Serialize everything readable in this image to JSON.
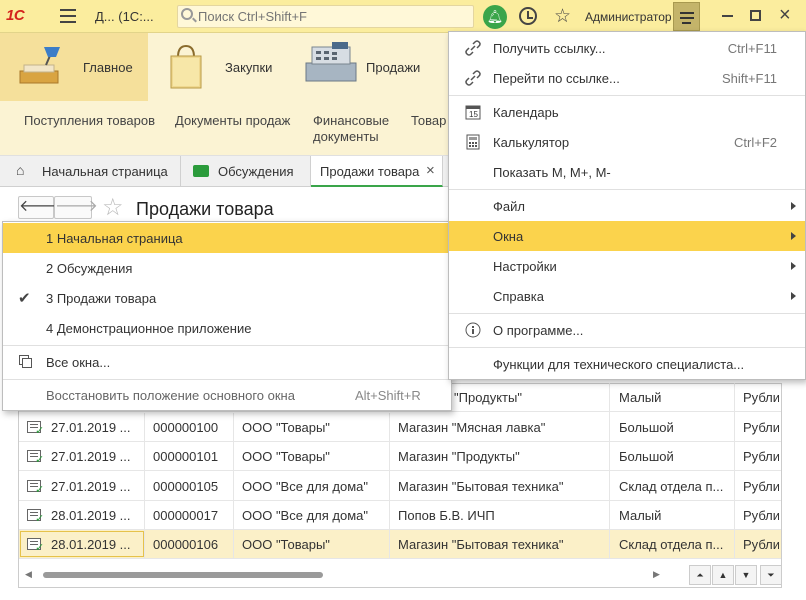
{
  "titlebar": {
    "logo": "1С",
    "title": "Д... (1С:...",
    "search_placeholder": "Поиск Ctrl+Shift+F",
    "user": "Администратор"
  },
  "sections": [
    {
      "label": "Главное"
    },
    {
      "label": "Закупки"
    },
    {
      "label": "Продажи"
    }
  ],
  "subsections": [
    {
      "label": "Поступления товаров"
    },
    {
      "label": "Документы продаж"
    },
    {
      "label": "Финансовые документы"
    },
    {
      "label": "Товар"
    }
  ],
  "tabs": [
    {
      "label": "Начальная страница"
    },
    {
      "label": "Обсуждения"
    },
    {
      "label": "Продажи товара"
    }
  ],
  "page": {
    "title": "Продажи товара"
  },
  "main_menu": {
    "items": [
      {
        "label": "Получить ссылку...",
        "shortcut": "Ctrl+F11",
        "icon": "link-icon"
      },
      {
        "label": "Перейти по ссылке...",
        "shortcut": "Shift+F11",
        "icon": "goto-link-icon"
      },
      {
        "label": "Календарь",
        "shortcut": "",
        "icon": "calendar-icon"
      },
      {
        "label": "Калькулятор",
        "shortcut": "Ctrl+F2",
        "icon": "calculator-icon"
      },
      {
        "label": "Показать M, M+, M-",
        "shortcut": ""
      },
      {
        "label": "Файл",
        "submenu": true
      },
      {
        "label": "Окна",
        "submenu": true,
        "highlighted": true
      },
      {
        "label": "Настройки",
        "submenu": true
      },
      {
        "label": "Справка",
        "submenu": true
      },
      {
        "label": "О программе...",
        "icon": "info-icon"
      },
      {
        "label": "Функции для технического специалиста..."
      }
    ]
  },
  "windows_menu": {
    "items": [
      {
        "label": "1 Начальная страница",
        "highlighted": true
      },
      {
        "label": "2 Обсуждения"
      },
      {
        "label": "3 Продажи товара",
        "checked": true
      },
      {
        "label": "4 Демонстрационное приложение"
      },
      {
        "label": "Все окна..."
      },
      {
        "label": "Восстановить положение основного окна",
        "shortcut": "Alt+Shift+R"
      }
    ]
  },
  "table": {
    "rows": [
      {
        "date": "",
        "number": "",
        "org": "",
        "store": "\"Продукты\"",
        "type": "Малый",
        "currency": "Рубли"
      },
      {
        "date": "27.01.2019 ...",
        "number": "000000100",
        "org": "ООО \"Товары\"",
        "store": "Магазин \"Мясная лавка\"",
        "type": "Большой",
        "currency": "Рубли"
      },
      {
        "date": "27.01.2019 ...",
        "number": "000000101",
        "org": "ООО \"Товары\"",
        "store": "Магазин \"Продукты\"",
        "type": "Большой",
        "currency": "Рубли"
      },
      {
        "date": "27.01.2019 ...",
        "number": "000000105",
        "org": "ООО \"Все для дома\"",
        "store": "Магазин \"Бытовая техника\"",
        "type": "Склад отдела п...",
        "currency": "Рубли"
      },
      {
        "date": "28.01.2019 ...",
        "number": "000000017",
        "org": "ООО \"Все для дома\"",
        "store": "Попов Б.В. ИЧП",
        "type": "Малый",
        "currency": "Рубли"
      },
      {
        "date": "28.01.2019 ...",
        "number": "000000106",
        "org": "ООО \"Товары\"",
        "store": "Магазин \"Бытовая техника\"",
        "type": "Склад отдела п...",
        "currency": "Рубли",
        "selected": true
      }
    ]
  }
}
